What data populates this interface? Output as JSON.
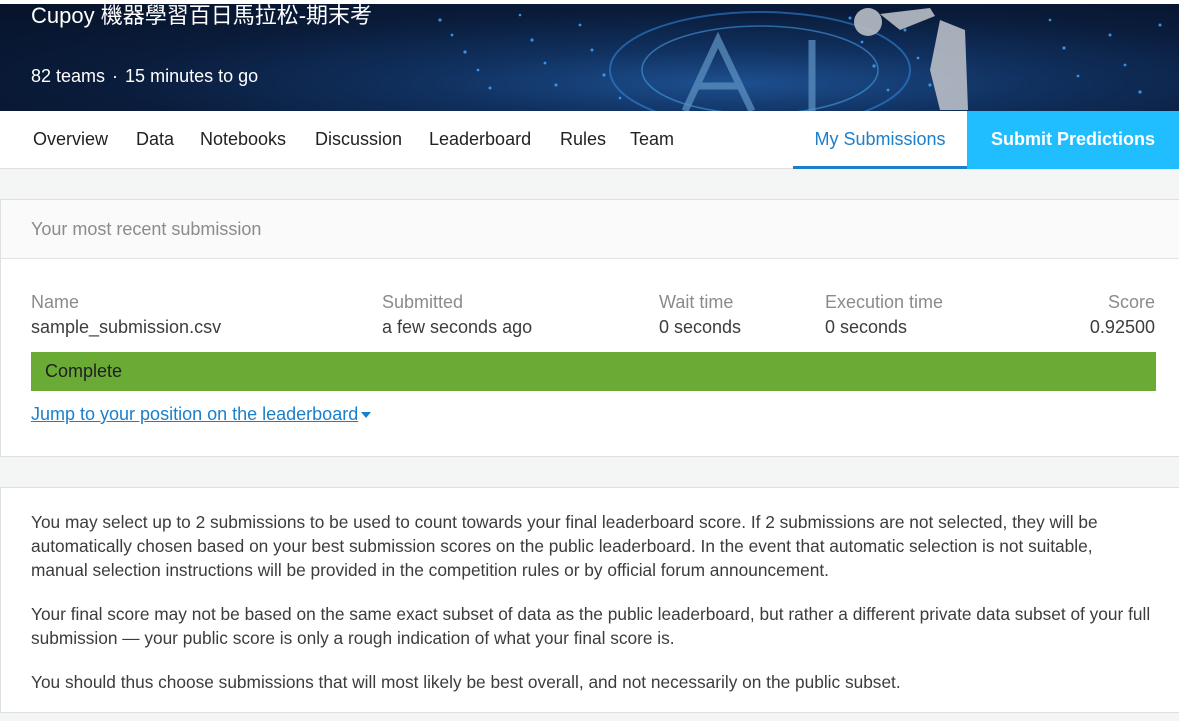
{
  "banner": {
    "title": "Cupoy 機器學習百日馬拉松-期末考",
    "teams": "82 teams",
    "separator": "·",
    "time_left": "15 minutes to go"
  },
  "tabs": [
    {
      "label": "Overview"
    },
    {
      "label": "Data"
    },
    {
      "label": "Notebooks"
    },
    {
      "label": "Discussion"
    },
    {
      "label": "Leaderboard"
    },
    {
      "label": "Rules"
    },
    {
      "label": "Team"
    }
  ],
  "my_submissions_tab": "My Submissions",
  "submit_button": "Submit Predictions",
  "recent": {
    "header": "Your most recent submission",
    "columns": {
      "name": {
        "label": "Name",
        "value": "sample_submission.csv"
      },
      "submitted": {
        "label": "Submitted",
        "value": "a few seconds ago"
      },
      "wait": {
        "label": "Wait time",
        "value": "0 seconds"
      },
      "execution": {
        "label": "Execution time",
        "value": "0 seconds"
      },
      "score": {
        "label": "Score",
        "value": "0.92500"
      }
    },
    "status": "Complete",
    "status_color": "#6aab36",
    "jump_link": "Jump to your position on the leaderboard"
  },
  "info": {
    "p1": "You may select up to 2 submissions to be used to count towards your final leaderboard score. If 2 submissions are not selected, they will be automatically chosen based on your best submission scores on the public leaderboard. In the event that automatic selection is not suitable, manual selection instructions will be provided in the competition rules or by official forum announcement.",
    "p2": "Your final score may not be based on the same exact subset of data as the public leaderboard, but rather a different private data subset of your full submission — your public score is only a rough indication of what your final score is.",
    "p3": "You should thus choose submissions that will most likely be best overall, and not necessarily on the public subset."
  },
  "colors": {
    "accent": "#1c7fcb",
    "submit_bg": "#20beff"
  }
}
